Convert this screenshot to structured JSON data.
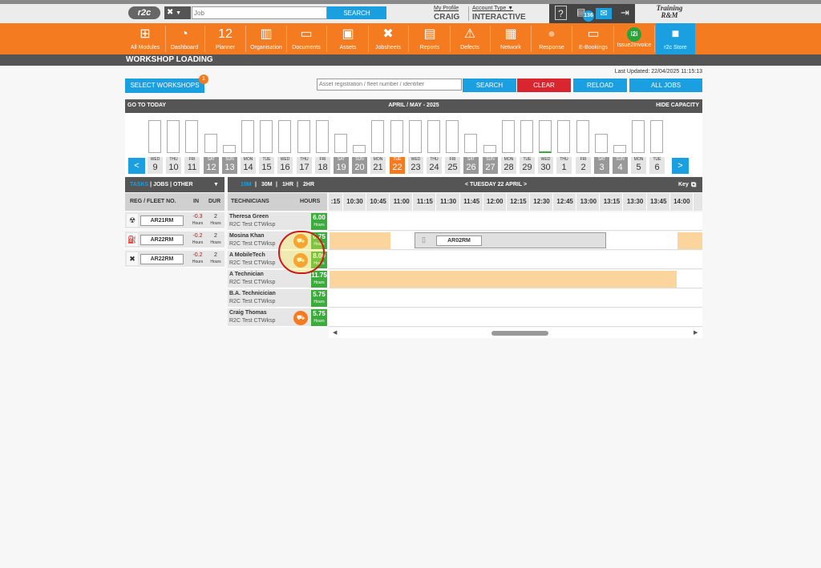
{
  "header": {
    "logo": "r2c",
    "job_placeholder": "Job",
    "search_label": "SEARCH",
    "my_profile": "My Profile",
    "username": "CRAIG",
    "account_type": "Account Type ▼",
    "account_value": "INTERACTIVE",
    "help": "?",
    "notif_count": "136",
    "env_line1": "Training",
    "env_line2": "R&M"
  },
  "nav": [
    {
      "label": "All Modules",
      "icon": "⊞"
    },
    {
      "label": "Dashboard",
      "icon": "◔"
    },
    {
      "label": "Planner",
      "icon": "12"
    },
    {
      "label": "Organisation",
      "icon": "▥"
    },
    {
      "label": "Documents",
      "icon": "▭"
    },
    {
      "label": "Assets",
      "icon": "▣"
    },
    {
      "label": "Jobsheets",
      "icon": "✖"
    },
    {
      "label": "Reports",
      "icon": "▤"
    },
    {
      "label": "Defects",
      "icon": "⚠"
    },
    {
      "label": "Network",
      "icon": "▦"
    },
    {
      "label": "Response",
      "icon": "●"
    },
    {
      "label": "E-Bookings",
      "icon": "▭"
    },
    {
      "label": "Issue2Invoice",
      "icon": "i2i"
    },
    {
      "label": "r2c Store",
      "icon": "■"
    }
  ],
  "page": {
    "title": "WORKSHOP LOADING",
    "last_updated": "Last Updated: 22/04/2025 11:15:13"
  },
  "controls": {
    "select_workshops": "SELECT WORKSHOPS",
    "select_badge": "1",
    "asset_placeholder": "Asset registration / fleet number / identifier",
    "search": "SEARCH",
    "clear": "CLEAR",
    "reload": "RELOAD",
    "all_jobs": "ALL JOBS",
    "colors": {
      "blue": "#1a9fe0",
      "red": "#d9262e",
      "orange": "#f47b20"
    }
  },
  "calendar": {
    "go_today": "GO TO TODAY",
    "range": "APRIL / MAY - 2025",
    "hide_capacity": "HIDE CAPACITY",
    "prev": "<",
    "next": ">",
    "days": [
      {
        "d": "WED",
        "n": "9",
        "w": false,
        "load": 0.82
      },
      {
        "d": "THU",
        "n": "10",
        "w": false,
        "load": 0.82
      },
      {
        "d": "FRI",
        "n": "11",
        "w": false,
        "load": 0.82
      },
      {
        "d": "SAT",
        "n": "12",
        "w": true,
        "load": 0.48
      },
      {
        "d": "SUN",
        "n": "13",
        "w": true,
        "load": 0.2
      },
      {
        "d": "MON",
        "n": "14",
        "w": false,
        "load": 0.82
      },
      {
        "d": "TUE",
        "n": "15",
        "w": false,
        "load": 0.82
      },
      {
        "d": "WED",
        "n": "16",
        "w": false,
        "load": 0.82
      },
      {
        "d": "THU",
        "n": "17",
        "w": false,
        "load": 0.82
      },
      {
        "d": "FRI",
        "n": "18",
        "w": false,
        "load": 0.82
      },
      {
        "d": "SAT",
        "n": "19",
        "w": true,
        "load": 0.48
      },
      {
        "d": "SUN",
        "n": "20",
        "w": true,
        "load": 0.2
      },
      {
        "d": "MON",
        "n": "21",
        "w": false,
        "load": 0.82
      },
      {
        "d": "TUE",
        "n": "22",
        "w": false,
        "load": 0.82,
        "today": true
      },
      {
        "d": "WED",
        "n": "23",
        "w": false,
        "load": 0.82
      },
      {
        "d": "THU",
        "n": "24",
        "w": false,
        "load": 0.82
      },
      {
        "d": "FRI",
        "n": "25",
        "w": false,
        "load": 0.82
      },
      {
        "d": "SAT",
        "n": "26",
        "w": true,
        "load": 0.48
      },
      {
        "d": "SUN",
        "n": "27",
        "w": true,
        "load": 0.2
      },
      {
        "d": "MON",
        "n": "28",
        "w": false,
        "load": 0.82
      },
      {
        "d": "TUE",
        "n": "29",
        "w": false,
        "load": 0.82
      },
      {
        "d": "WED",
        "n": "30",
        "w": false,
        "load": 0.82,
        "used": 0.04
      },
      {
        "d": "THU",
        "n": "1",
        "w": false,
        "load": 0.82
      },
      {
        "d": "FRI",
        "n": "2",
        "w": false,
        "load": 0.82
      },
      {
        "d": "SAT",
        "n": "3",
        "w": true,
        "load": 0.48
      },
      {
        "d": "SUN",
        "n": "4",
        "w": true,
        "load": 0.2
      },
      {
        "d": "MON",
        "n": "5",
        "w": false,
        "load": 0.82
      },
      {
        "d": "TUE",
        "n": "6",
        "w": false,
        "load": 0.82
      }
    ]
  },
  "tasks": {
    "tab_tasks": "TASKS",
    "tab_jobs": "JOBS",
    "tab_other": "OTHER",
    "col_reg": "REG / FLEET NO.",
    "col_in": "IN",
    "col_dur": "DUR",
    "rows": [
      {
        "icon": "☢",
        "reg": "AR21RM",
        "in": "-0.3",
        "dur": "2",
        "unit": "Hours"
      },
      {
        "icon": "⛽",
        "reg": "AR22RM",
        "in": "-0.2",
        "dur": "2",
        "unit": "Hours"
      },
      {
        "icon": "✖",
        "reg": "AR22RM",
        "in": "-0.2",
        "dur": "2",
        "unit": "Hours"
      }
    ]
  },
  "schedule": {
    "zoom_15m": "15M",
    "zoom_30m": "30M",
    "zoom_1hr": "1HR",
    "zoom_2hr": "2HR",
    "date_nav": "<   TUESDAY 22 APRIL   >",
    "key": "Key",
    "col_tech": "TECHNICIANS",
    "col_hours": "HOURS",
    "times": [
      ":15",
      "10:30",
      "10:45",
      "11:00",
      "11:15",
      "11:30",
      "11:45",
      "12:00",
      "12:15",
      "12:30",
      "12:45",
      "13:00",
      "13:15",
      "13:30",
      "13:45",
      "14:00"
    ],
    "techs": [
      {
        "name": "Theresa Green",
        "ws": "R2C Test CTWksp",
        "hours": "6.00",
        "unit": "Hours",
        "van": false
      },
      {
        "name": "Mosina Khan",
        "ws": "R2C Test CTWksp",
        "hours": "0.75",
        "unit": "Hours",
        "van": true
      },
      {
        "name": "A MobileTech",
        "ws": "R2C Test CTWksp",
        "hours": "8.00",
        "unit": "Hours",
        "van": true
      },
      {
        "name": "A Technician",
        "ws": "R2C Test CTWksp",
        "hours": "11.75",
        "unit": "Hours",
        "van": false
      },
      {
        "name": "B.A. Technicician",
        "ws": "R2C Test CTWksp",
        "hours": "5.75",
        "unit": "Hours",
        "van": false
      },
      {
        "name": "Craig Thomas",
        "ws": "R2C Test CTWksp",
        "hours": "5.75",
        "unit": "Hours",
        "van": true
      }
    ],
    "job_card_reg": "AR02RM"
  }
}
